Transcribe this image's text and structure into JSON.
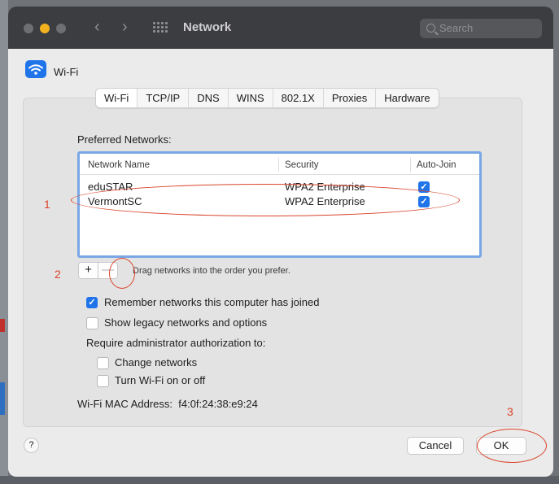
{
  "window": {
    "title": "Network",
    "search_placeholder": "Search"
  },
  "service": {
    "name": "Wi-Fi",
    "icon": "wifi-icon"
  },
  "tabs": [
    {
      "label": "Wi-Fi",
      "active": true
    },
    {
      "label": "TCP/IP"
    },
    {
      "label": "DNS"
    },
    {
      "label": "WINS"
    },
    {
      "label": "802.1X"
    },
    {
      "label": "Proxies"
    },
    {
      "label": "Hardware"
    }
  ],
  "preferred": {
    "label": "Preferred Networks:",
    "columns": [
      "Network Name",
      "Security",
      "Auto-Join"
    ],
    "rows": [
      {
        "name": "eduSTAR",
        "security": "WPA2 Enterprise",
        "auto_join": true
      },
      {
        "name": "VermontSC",
        "security": "WPA2 Enterprise",
        "auto_join": true
      }
    ],
    "add_label": "+",
    "remove_label": "—",
    "drag_hint": "Drag networks into the order you prefer."
  },
  "options": {
    "remember": {
      "label": "Remember networks this computer has joined",
      "checked": true
    },
    "legacy": {
      "label": "Show legacy networks and options",
      "checked": false
    },
    "require_label": "Require administrator authorization to:",
    "change": {
      "label": "Change networks",
      "checked": false
    },
    "toggle": {
      "label": "Turn Wi-Fi on or off",
      "checked": false
    }
  },
  "mac": {
    "label": "Wi-Fi MAC Address:",
    "value": "f4:0f:24:38:e9:24"
  },
  "footer": {
    "help_label": "?",
    "cancel_label": "Cancel",
    "ok_label": "OK"
  },
  "annotations": {
    "step1": "1",
    "step2": "2",
    "step3": "3"
  },
  "colors": {
    "accent": "#1f74ea",
    "annotation": "#d9442a",
    "table_focus": "#79a7e6"
  }
}
